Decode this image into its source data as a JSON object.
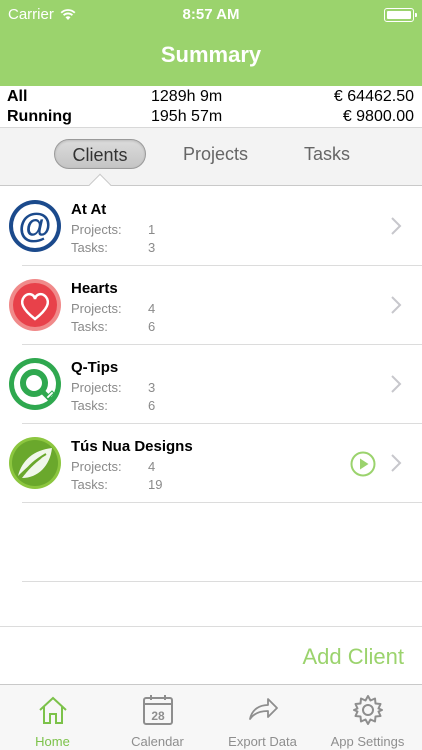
{
  "status_bar": {
    "carrier": "Carrier",
    "time": "8:57 AM"
  },
  "header": {
    "title": "Summary"
  },
  "summary": {
    "rows": [
      {
        "label": "All",
        "hours": "1289h 9m",
        "amount": "€ 64462.50"
      },
      {
        "label": "Running",
        "hours": "195h 57m",
        "amount": "€ 9800.00"
      }
    ]
  },
  "segment": {
    "tabs": [
      "Clients",
      "Projects",
      "Tasks"
    ],
    "selected": "Clients"
  },
  "clients": [
    {
      "name": "At At",
      "projects_label": "Projects:",
      "projects": "1",
      "tasks_label": "Tasks:",
      "tasks": "3",
      "logo": "at-sign-icon",
      "running": false
    },
    {
      "name": "Hearts",
      "projects_label": "Projects:",
      "projects": "4",
      "tasks_label": "Tasks:",
      "tasks": "6",
      "logo": "heart-icon",
      "running": false
    },
    {
      "name": "Q-Tips",
      "projects_label": "Projects:",
      "projects": "3",
      "tasks_label": "Tasks:",
      "tasks": "6",
      "logo": "q-letter-icon",
      "running": false
    },
    {
      "name": "Tús Nua Designs",
      "projects_label": "Projects:",
      "projects": "4",
      "tasks_label": "Tasks:",
      "tasks": "19",
      "logo": "leaf-icon",
      "running": true
    }
  ],
  "add_client_label": "Add Client",
  "tabbar": {
    "items": [
      {
        "label": "Home",
        "icon": "home-icon",
        "active": true
      },
      {
        "label": "Calendar",
        "icon": "calendar-icon",
        "active": false,
        "badge": "28"
      },
      {
        "label": "Export Data",
        "icon": "share-arrow-icon",
        "active": false
      },
      {
        "label": "App Settings",
        "icon": "gear-icon",
        "active": false
      }
    ]
  },
  "colors": {
    "accent": "#9bd36d",
    "active_tab": "#7cc24a",
    "muted_text": "#8a8a8a"
  }
}
